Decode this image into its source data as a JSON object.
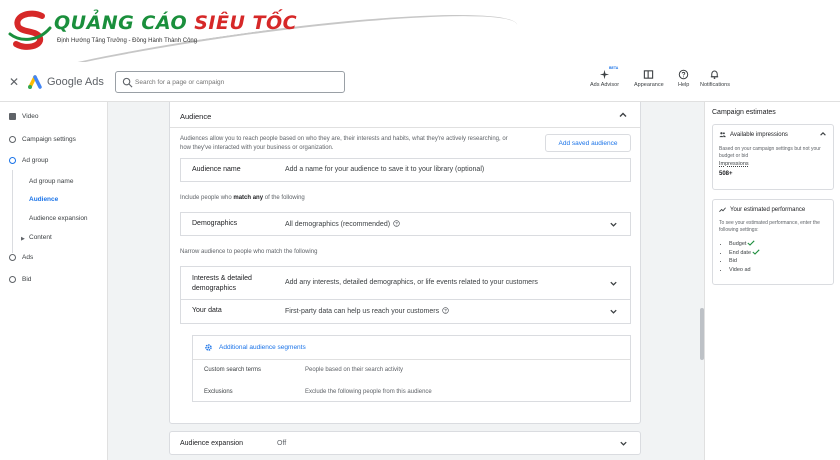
{
  "brand": {
    "title_green": "QUẢNG CÁO ",
    "title_red": "SIÊU TỐC",
    "subtitle": "Định Hướng Tăng Trưởng - Đồng Hành Thành Công"
  },
  "topbar": {
    "app_name": "Google Ads",
    "search_placeholder": "Search for a page or campaign",
    "tools": [
      {
        "label": "Ads Advisor",
        "icon": "sparkle-icon",
        "badge": "BETA"
      },
      {
        "label": "Appearance",
        "icon": "appearance-icon"
      },
      {
        "label": "Help",
        "icon": "help-icon"
      },
      {
        "label": "Notifications",
        "icon": "bell-icon"
      }
    ]
  },
  "leftnav": {
    "items": [
      {
        "label": "Video",
        "icon": "video-icon"
      },
      {
        "label": "Campaign settings"
      },
      {
        "label": "Ad group",
        "active": true
      },
      {
        "label": "Bid"
      },
      {
        "label": "Ads"
      }
    ],
    "sub_items": [
      "Ad group name",
      "Audience",
      "Audience expansion",
      "Content"
    ],
    "active_sub": "Audience"
  },
  "audience_card": {
    "title": "Audience",
    "description": "Audiences allow you to reach people based on who they are, their interests and habits, what they're actively researching, or how they've interacted with your business or organization.",
    "saved_button": "Add saved audience",
    "audience_name": {
      "label": "Audience name",
      "placeholder": "Add a name for your audience to save it to your library (optional)"
    },
    "include_prefix": "Include people who ",
    "include_bold": "match any",
    "include_suffix": " of the following",
    "demographics": {
      "label": "Demographics",
      "value": "All demographics (recommended)"
    },
    "narrow_text": "Narrow audience to people who match the following",
    "interests": {
      "label": "Interests & detailed demographics",
      "value": "Add any interests, detailed demographics, or life events related to your customers"
    },
    "your_data": {
      "label": "Your data",
      "value": "First-party data can help us reach your customers"
    },
    "segments": {
      "title": "Additional audience segments",
      "rows": [
        {
          "key": "Custom search terms",
          "value": "People based on their search activity"
        },
        {
          "key": "Exclusions",
          "value": "Exclude the following people from this audience"
        }
      ]
    }
  },
  "audience_expansion": {
    "label": "Audience expansion",
    "value": "Off"
  },
  "estimates": {
    "title": "Campaign estimates",
    "impressions": {
      "title": "Available impressions",
      "text": "Based on your campaign settings but not your budget or bid",
      "label": "Impressions",
      "value": "508+"
    },
    "performance": {
      "title": "Your estimated performance",
      "text": "To see your estimated performance, enter the following settings:",
      "items": [
        {
          "label": "Budget",
          "done": true
        },
        {
          "label": "End date",
          "done": true
        },
        {
          "label": "Bid",
          "done": false
        },
        {
          "label": "Video ad",
          "done": false
        }
      ]
    }
  },
  "colors": {
    "accent": "#1a73e8",
    "brand_green": "#1a8f3c",
    "brand_red": "#d62828",
    "check_green": "#1e8e3e"
  }
}
